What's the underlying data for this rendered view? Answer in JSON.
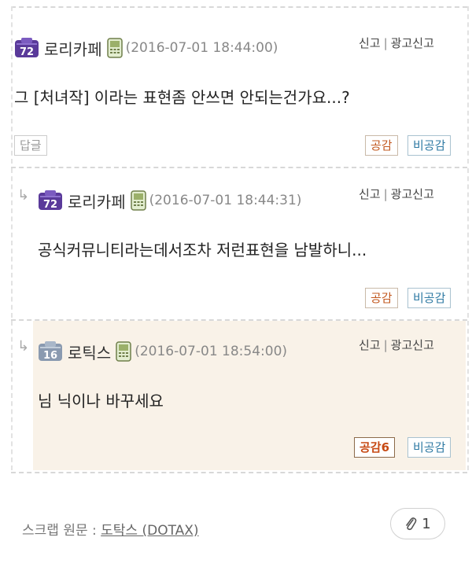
{
  "comments": [
    {
      "level": "72",
      "nickname": "로리카페",
      "date": "(2016-07-01 18:44:00)",
      "report": "신고",
      "ad_report": "광고신고",
      "text": "그 [처녀작] 이라는 표현좀 안쓰면 안되는건가요...?",
      "reply_label": "답글",
      "like_label": "공감",
      "dislike_label": "비공감"
    },
    {
      "level": "72",
      "nickname": "로리카페",
      "date": "(2016-07-01 18:44:31)",
      "report": "신고",
      "ad_report": "광고신고",
      "text": "공식커뮤니티라는데서조차 저런표현을 남발하니...",
      "like_label": "공감",
      "dislike_label": "비공감"
    },
    {
      "level": "16",
      "nickname": "로틱스",
      "date": "(2016-07-01 18:54:00)",
      "report": "신고",
      "ad_report": "광고신고",
      "text": "님 닉이나 바꾸세요",
      "like_label": "공감6",
      "dislike_label": "비공감"
    }
  ],
  "reply_arrow": "↳",
  "footer": {
    "scrap_label": "스크랩 원문 :",
    "source_link": "도탁스 (DOTAX)",
    "attach_count": "1"
  },
  "colors": {
    "level_badge_high": "#5a3a9a",
    "level_badge_low": "#8a9ab0",
    "highlight_bg": "#f9f2e8",
    "like_text": "#c2581f",
    "dislike_text": "#2f7aa3"
  }
}
